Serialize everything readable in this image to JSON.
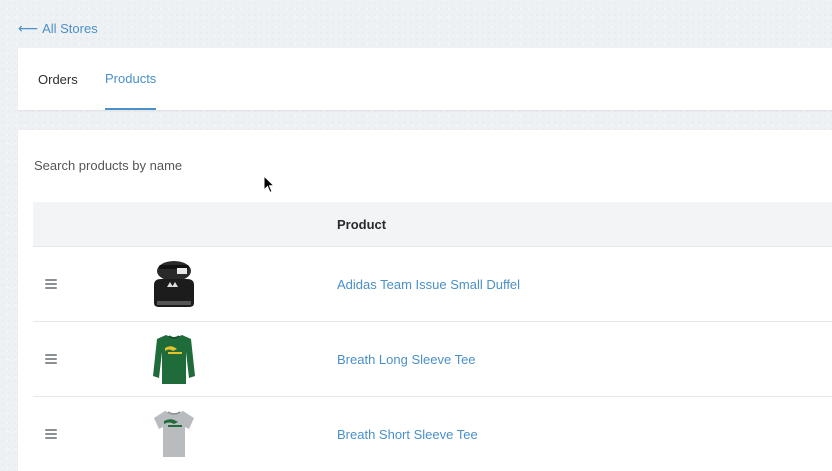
{
  "nav": {
    "back_arrow": "⟵",
    "back_label": "All Stores"
  },
  "tabs": [
    {
      "label": "Orders",
      "active": false
    },
    {
      "label": "Products",
      "active": true
    }
  ],
  "search": {
    "placeholder": "Search products by name",
    "value": ""
  },
  "table": {
    "columns": [
      "",
      "",
      "Product"
    ],
    "rows": [
      {
        "name": "Adidas Team Issue Small Duffel",
        "image_icon": "duffel-bag-icon"
      },
      {
        "name": "Breath Long Sleeve Tee",
        "image_icon": "long-sleeve-tee-icon"
      },
      {
        "name": "Breath Short Sleeve Tee",
        "image_icon": "short-sleeve-tee-icon"
      }
    ]
  },
  "colors": {
    "accent": "#4a90c9",
    "page_bg": "#eef1f4",
    "header_bg": "#f3f4f6",
    "tee_green": "#1f6b3a",
    "tee_grey": "#b9bcbe"
  }
}
